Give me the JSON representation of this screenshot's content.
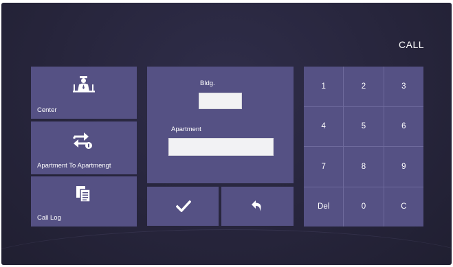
{
  "header": {
    "title": "CALL"
  },
  "menu": {
    "center_label": "Center",
    "apartment_label": "Apartment To Apartmengt",
    "calllog_label": "Call Log"
  },
  "form": {
    "bldg_label": "Bldg.",
    "bldg_value": "",
    "apartment_label": "Apartment",
    "apartment_value": ""
  },
  "actions": {
    "confirm_icon": "check-icon",
    "back_icon": "undo-icon"
  },
  "keypad": {
    "keys": [
      "1",
      "2",
      "3",
      "4",
      "5",
      "6",
      "7",
      "8",
      "9",
      "Del",
      "0",
      "C"
    ]
  },
  "icons": {
    "center": "guard-icon",
    "apartment": "swap-arrows-icon",
    "calllog": "documents-icon"
  },
  "colors": {
    "background": "#27253c",
    "tile": "#555184",
    "text": "#ffffff"
  }
}
